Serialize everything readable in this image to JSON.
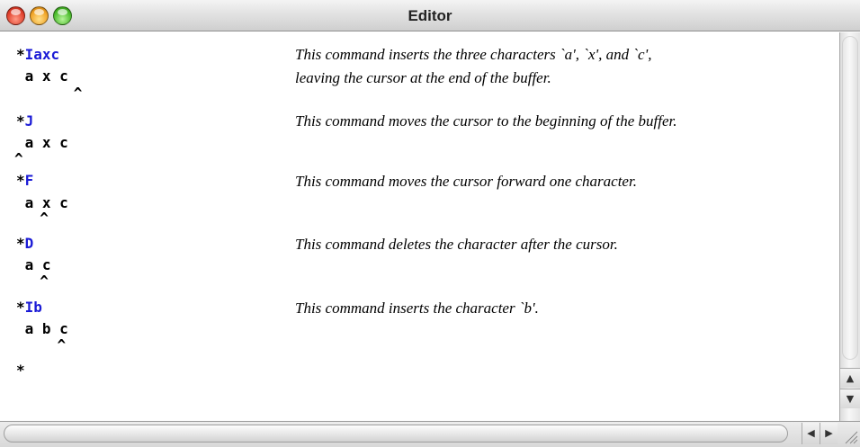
{
  "window": {
    "title": "Editor"
  },
  "entries": [
    {
      "prompt": "*",
      "command": "Iaxc",
      "buffer": " a x c",
      "cursor": "      ^",
      "description": "This command inserts the three characters `a', `x', and `c',",
      "description2": "leaving the cursor at the end of the buffer."
    },
    {
      "prompt": "*",
      "command": "J",
      "buffer": " a x c",
      "cursor": "^",
      "description": "This command moves the cursor to the beginning of the buffer."
    },
    {
      "prompt": "*",
      "command": "F",
      "buffer": " a x c",
      "cursor": "  ^",
      "description": "This command moves the cursor forward one character."
    },
    {
      "prompt": "*",
      "command": "D",
      "buffer": " a c",
      "cursor": "  ^",
      "description": "This command deletes the character after the cursor."
    },
    {
      "prompt": "*",
      "command": "Ib",
      "buffer": " a b c",
      "cursor": "    ^",
      "description": "This command inserts the character `b'."
    }
  ],
  "final_prompt": "*",
  "colors": {
    "command": "#1b1bd6",
    "text": "#000000"
  },
  "icons": {
    "close": "close-icon",
    "minimize": "minimize-icon",
    "zoom": "zoom-icon",
    "scroll_up": "arrow-up-icon",
    "scroll_down": "arrow-down-icon",
    "scroll_left": "arrow-left-icon",
    "scroll_right": "arrow-right-icon",
    "resize": "resize-grip-icon"
  }
}
